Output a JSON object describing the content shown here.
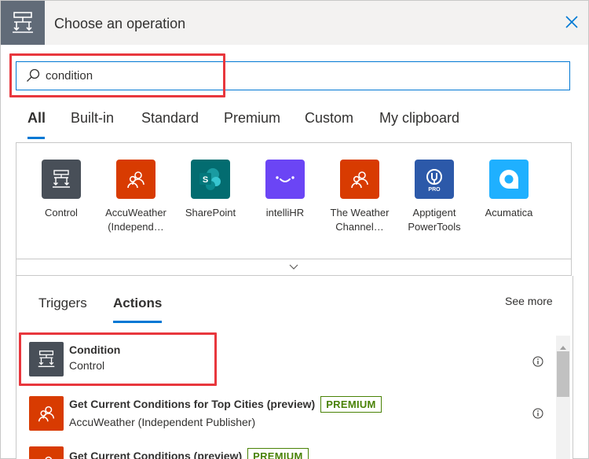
{
  "header": {
    "title": "Choose an operation",
    "icon": "control-icon",
    "close_icon": "close-icon"
  },
  "search": {
    "value": "condition",
    "icon": "search-icon"
  },
  "tabs": [
    {
      "label": "All",
      "selected": true
    },
    {
      "label": "Built-in",
      "selected": false
    },
    {
      "label": "Standard",
      "selected": false
    },
    {
      "label": "Premium",
      "selected": false
    },
    {
      "label": "Custom",
      "selected": false
    },
    {
      "label": "My clipboard",
      "selected": false
    }
  ],
  "connectors": [
    {
      "line1": "Control",
      "line2": "",
      "color": "#484f58",
      "icon": "control-icon"
    },
    {
      "line1": "AccuWeather",
      "line2": "(Independ…",
      "color": "#d83b01",
      "icon": "people-icon"
    },
    {
      "line1": "SharePoint",
      "line2": "",
      "color": "#036c70",
      "icon": "sharepoint-icon"
    },
    {
      "line1": "intelliHR",
      "line2": "",
      "color": "#6b45f5",
      "icon": "smile-icon"
    },
    {
      "line1": "The Weather",
      "line2": "Channel…",
      "color": "#d83b01",
      "icon": "people-icon"
    },
    {
      "line1": "Apptigent",
      "line2": "PowerTools",
      "color": "#2c59a9",
      "icon": "pro-icon"
    },
    {
      "line1": "Acumatica",
      "line2": "",
      "color": "#1fb0ff",
      "icon": "acumatica-icon"
    }
  ],
  "subtabs": [
    {
      "label": "Triggers",
      "selected": false
    },
    {
      "label": "Actions",
      "selected": true
    }
  ],
  "see_more": "See more",
  "actions": [
    {
      "title": "Condition",
      "subtitle": "Control",
      "badge": "",
      "color": "#484f58",
      "icon": "control-icon"
    },
    {
      "title": "Get Current Conditions for Top Cities (preview)",
      "subtitle": "AccuWeather (Independent Publisher)",
      "badge": "PREMIUM",
      "color": "#d83b01",
      "icon": "people-icon"
    },
    {
      "title": "Get Current Conditions (preview)",
      "subtitle": "",
      "badge": "PREMIUM",
      "color": "#d83b01",
      "icon": "people-icon"
    }
  ],
  "colors": {
    "accent": "#0078d4",
    "highlight": "#e8373d",
    "premium": "#498205"
  }
}
